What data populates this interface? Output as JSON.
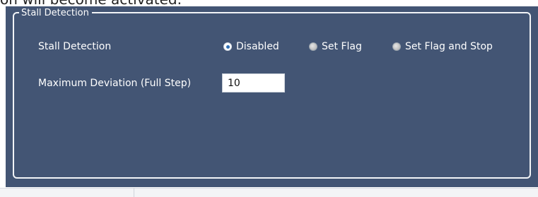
{
  "document": {
    "caption": "on will become activated."
  },
  "group": {
    "title": "Stall Detection"
  },
  "stall_detection": {
    "label": "Stall Detection",
    "selected": "Disabled",
    "options": [
      {
        "label": "Disabled",
        "selected": true
      },
      {
        "label": "Set Flag",
        "selected": false
      },
      {
        "label": "Set Flag and Stop",
        "selected": false
      }
    ]
  },
  "max_deviation": {
    "label": "Maximum Deviation (Full Step)",
    "value": "10"
  },
  "colors": {
    "panel_background": "#435574",
    "group_border": "#f2f4f7",
    "label_text": "#ffffff",
    "radio_selected_dot": "#2f6fb5"
  }
}
